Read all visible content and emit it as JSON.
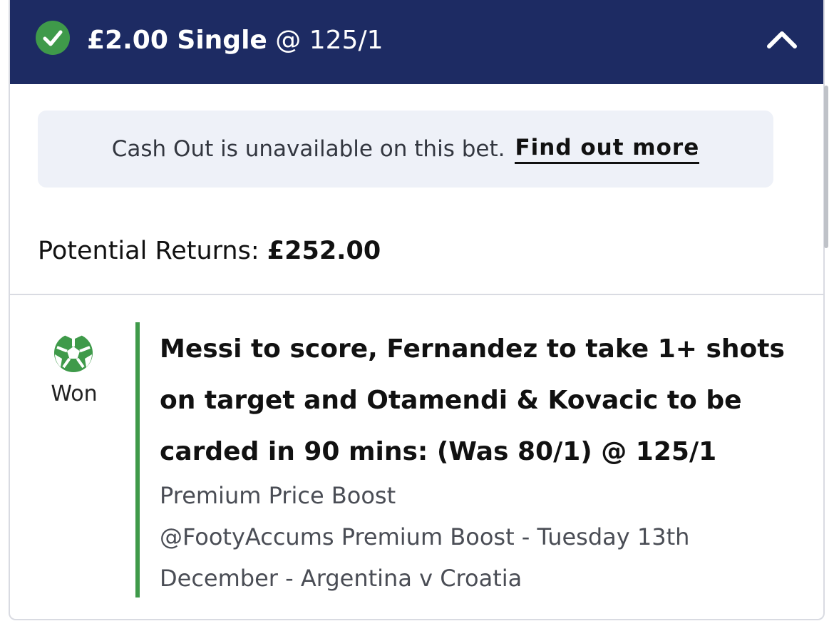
{
  "header": {
    "stake_label": "£2.00 Single",
    "odds_label": "@ 125/1",
    "status_icon": "check-circle-icon",
    "toggle_icon": "chevron-up-icon"
  },
  "notice": {
    "text": "Cash Out is unavailable on this bet.",
    "link_label": "Find out more"
  },
  "returns": {
    "label": "Potential Returns:",
    "amount": "£252.00"
  },
  "leg": {
    "sport_icon": "football-icon",
    "status": "Won",
    "selection": "Messi to score, Fernandez to take 1+ shots on target and Otamendi & Kovacic to be carded in 90 mins: (Was 80/1) @ 125/1",
    "market": "Premium Price Boost",
    "event_line1": "@FootyAccums Premium Boost - Tuesday 13th",
    "event_line2": "December - Argentina v Croatia"
  },
  "colors": {
    "header_bg": "#1d2b63",
    "won_green": "#3f9a4a",
    "notice_bg": "#eef1f8"
  }
}
